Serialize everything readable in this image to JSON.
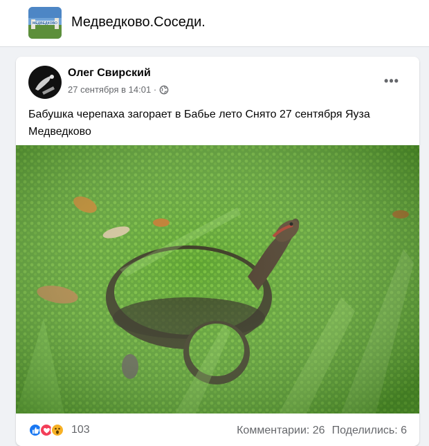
{
  "group": {
    "name": "Медведково.Соседи.",
    "avatar_icon": "group-cover-photo"
  },
  "post": {
    "author": "Олег Свирский",
    "timestamp": "27 сентября в 14:01",
    "privacy_icon": "globe-icon",
    "more_label": "•••",
    "text": "Бабушка черепаха загорает в Бабье лето Снято 27 сентября  Яуза Медведково",
    "photo_description_icon": "turtle-photo"
  },
  "footer": {
    "reactions": [
      "like",
      "love",
      "wow"
    ],
    "reaction_count": "103",
    "comments": "Комментарии: 26",
    "shares": "Поделились: 6"
  },
  "colors": {
    "like": "#1877f2",
    "love": "#f33e58",
    "wow": "#f7b125",
    "secondary_text": "#65676b"
  }
}
